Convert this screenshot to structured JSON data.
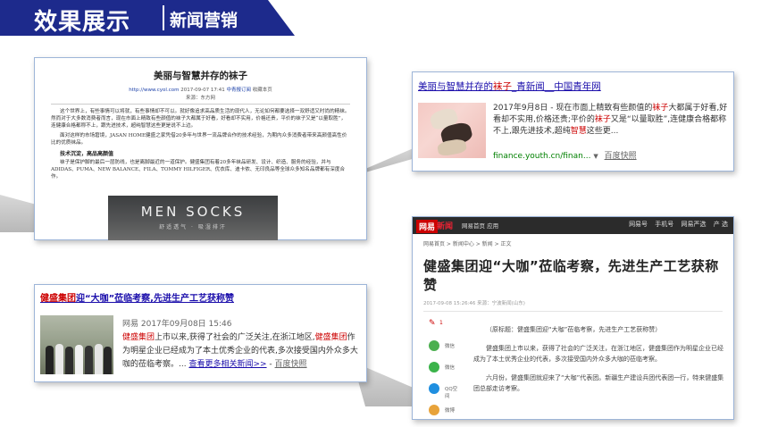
{
  "header": {
    "title": "效果展示",
    "subtitle": "新闻营销",
    "colors": {
      "banner": "#1d2a8c",
      "text": "#ffffff"
    }
  },
  "article_card": {
    "title": "美丽与智慧并存的袜子",
    "meta_date": "2017-09-07 17:41",
    "meta_site": "中青报订阅",
    "meta_link": "http://www.cyol.com",
    "meta_extra": "收藏本页",
    "source": "来源：东方网",
    "paragraphs": [
      "这个世界上，有些事情可以将就，有些事情却不可以。就好像追求高品质生活的现代人，无论如何都要选择一双舒适又时尚的精袜。然而对于大多数消费者而言，现在市面上精致有些颜值的袜子大都属于好看，好看却不实用，价格还贵，平价的袜子又是“以量取胜”，连健康合格都称不上，跟先进技术，超纯智慧这些更是说不上边。",
      "面对这样的市场窘境，JASAN HOME健盛之家凭借20多年与世界一流品牌合作的技术经验，为期内众多消费者带来高颜值高性价比的优质袜品。"
    ],
    "heading": "技术沉淀，高品高颜值",
    "paragraph3": "袜子是保护脚的最后一层防线，也是离脚最近的一道保护。健盛集团有着20多年袜品研发、设计、织造、服务的经验，并与ADIDAS、PUMA、NEW BALANCE、FILA、TOMMY HILFIGER、优衣库、迪卡侬、无印良品等全球众多知名品牌都有深度合作。",
    "banner_title": "MEN SOCKS",
    "banner_sub": "舒适透气 · 吸湿排汗"
  },
  "search_result_1": {
    "title_part1": "美丽与智慧并存的",
    "title_hl": "袜子",
    "title_part2": "_青新闻__中国青年网",
    "snippet_1": "2017年9月8日 - 现在市面上精致有些颜值的",
    "snippet_hl1": "袜子",
    "snippet_2": "大都属于好看,好看却不实用,价格还贵;平价的",
    "snippet_hl2": "袜子",
    "snippet_3": "又是“以量取胜”,连健康合格都称不上,跟先进技术,超纯",
    "snippet_hl3": "智慧",
    "snippet_4": "这些更...",
    "url": "finance.youth.cn/finan...",
    "snapshot": "百度快照"
  },
  "search_result_2": {
    "title_hl": "健盛集团",
    "title_rest": "迎“大咖”莅临考察,先进生产工艺获称赞",
    "source": "网易  2017年09月08日 15:46",
    "snippet_hl1": "健盛集团",
    "snippet_1": "上市以来,获得了社会的广泛关注,在浙江地区,",
    "snippet_hl2": "健盛集团",
    "snippet_2": "作为明星企业已经成为了本土优秀企业的代表,多次接受国内外众多大咖的莅临考察。",
    "more_link": "查看更多相关新闻>>",
    "snapshot": "百度快照"
  },
  "netease_article": {
    "logo_a": "网易",
    "logo_b": "新闻",
    "nav": "网易首页  应用",
    "tools": [
      "网易号",
      "手机号",
      "网易严选",
      "产 选"
    ],
    "breadcrumb": "网易首页 > 新闻中心 > 新闻 > 正文",
    "headline": "健盛集团迎“大咖”莅临考察，先进生产工艺获称赞",
    "meta": "2017-09-08 15:26:46  来源：宁波新闻(山东)",
    "share": [
      {
        "label": "微信",
        "color": "#4caf50"
      },
      {
        "label": "微信",
        "color": "#3bb34a"
      },
      {
        "label": "QQ空间",
        "color": "#1f8fe0"
      },
      {
        "label": "微博",
        "color": "#e8a33a"
      }
    ],
    "comment_count": "1",
    "paragraph1": "（原标题：健盛集团迎“大咖”莅临考察，先进生产工艺获称赞）",
    "paragraph2": "健盛集团上市以来，获得了社会的广泛关注，在浙江地区，健盛集团作为明星企业已经成为了本土优秀企业的代表，多次接受国内外众多大咖的莅临考察。",
    "paragraph3": "六月份，健盛集团就迎来了“大咖”代表团。新疆生产建设兵团代表团一行，特来健盛集团总部走访考察。"
  }
}
